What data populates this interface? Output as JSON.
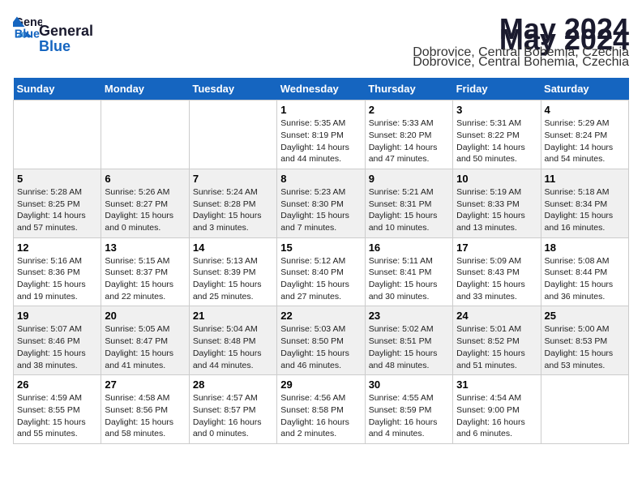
{
  "header": {
    "logo_general": "General",
    "logo_blue": "Blue",
    "month_year": "May 2024",
    "location": "Dobrovice, Central Bohemia, Czechia"
  },
  "weekdays": [
    "Sunday",
    "Monday",
    "Tuesday",
    "Wednesday",
    "Thursday",
    "Friday",
    "Saturday"
  ],
  "weeks": [
    [
      {
        "day": "",
        "info": ""
      },
      {
        "day": "",
        "info": ""
      },
      {
        "day": "",
        "info": ""
      },
      {
        "day": "1",
        "info": "Sunrise: 5:35 AM\nSunset: 8:19 PM\nDaylight: 14 hours\nand 44 minutes."
      },
      {
        "day": "2",
        "info": "Sunrise: 5:33 AM\nSunset: 8:20 PM\nDaylight: 14 hours\nand 47 minutes."
      },
      {
        "day": "3",
        "info": "Sunrise: 5:31 AM\nSunset: 8:22 PM\nDaylight: 14 hours\nand 50 minutes."
      },
      {
        "day": "4",
        "info": "Sunrise: 5:29 AM\nSunset: 8:24 PM\nDaylight: 14 hours\nand 54 minutes."
      }
    ],
    [
      {
        "day": "5",
        "info": "Sunrise: 5:28 AM\nSunset: 8:25 PM\nDaylight: 14 hours\nand 57 minutes."
      },
      {
        "day": "6",
        "info": "Sunrise: 5:26 AM\nSunset: 8:27 PM\nDaylight: 15 hours\nand 0 minutes."
      },
      {
        "day": "7",
        "info": "Sunrise: 5:24 AM\nSunset: 8:28 PM\nDaylight: 15 hours\nand 3 minutes."
      },
      {
        "day": "8",
        "info": "Sunrise: 5:23 AM\nSunset: 8:30 PM\nDaylight: 15 hours\nand 7 minutes."
      },
      {
        "day": "9",
        "info": "Sunrise: 5:21 AM\nSunset: 8:31 PM\nDaylight: 15 hours\nand 10 minutes."
      },
      {
        "day": "10",
        "info": "Sunrise: 5:19 AM\nSunset: 8:33 PM\nDaylight: 15 hours\nand 13 minutes."
      },
      {
        "day": "11",
        "info": "Sunrise: 5:18 AM\nSunset: 8:34 PM\nDaylight: 15 hours\nand 16 minutes."
      }
    ],
    [
      {
        "day": "12",
        "info": "Sunrise: 5:16 AM\nSunset: 8:36 PM\nDaylight: 15 hours\nand 19 minutes."
      },
      {
        "day": "13",
        "info": "Sunrise: 5:15 AM\nSunset: 8:37 PM\nDaylight: 15 hours\nand 22 minutes."
      },
      {
        "day": "14",
        "info": "Sunrise: 5:13 AM\nSunset: 8:39 PM\nDaylight: 15 hours\nand 25 minutes."
      },
      {
        "day": "15",
        "info": "Sunrise: 5:12 AM\nSunset: 8:40 PM\nDaylight: 15 hours\nand 27 minutes."
      },
      {
        "day": "16",
        "info": "Sunrise: 5:11 AM\nSunset: 8:41 PM\nDaylight: 15 hours\nand 30 minutes."
      },
      {
        "day": "17",
        "info": "Sunrise: 5:09 AM\nSunset: 8:43 PM\nDaylight: 15 hours\nand 33 minutes."
      },
      {
        "day": "18",
        "info": "Sunrise: 5:08 AM\nSunset: 8:44 PM\nDaylight: 15 hours\nand 36 minutes."
      }
    ],
    [
      {
        "day": "19",
        "info": "Sunrise: 5:07 AM\nSunset: 8:46 PM\nDaylight: 15 hours\nand 38 minutes."
      },
      {
        "day": "20",
        "info": "Sunrise: 5:05 AM\nSunset: 8:47 PM\nDaylight: 15 hours\nand 41 minutes."
      },
      {
        "day": "21",
        "info": "Sunrise: 5:04 AM\nSunset: 8:48 PM\nDaylight: 15 hours\nand 44 minutes."
      },
      {
        "day": "22",
        "info": "Sunrise: 5:03 AM\nSunset: 8:50 PM\nDaylight: 15 hours\nand 46 minutes."
      },
      {
        "day": "23",
        "info": "Sunrise: 5:02 AM\nSunset: 8:51 PM\nDaylight: 15 hours\nand 48 minutes."
      },
      {
        "day": "24",
        "info": "Sunrise: 5:01 AM\nSunset: 8:52 PM\nDaylight: 15 hours\nand 51 minutes."
      },
      {
        "day": "25",
        "info": "Sunrise: 5:00 AM\nSunset: 8:53 PM\nDaylight: 15 hours\nand 53 minutes."
      }
    ],
    [
      {
        "day": "26",
        "info": "Sunrise: 4:59 AM\nSunset: 8:55 PM\nDaylight: 15 hours\nand 55 minutes."
      },
      {
        "day": "27",
        "info": "Sunrise: 4:58 AM\nSunset: 8:56 PM\nDaylight: 15 hours\nand 58 minutes."
      },
      {
        "day": "28",
        "info": "Sunrise: 4:57 AM\nSunset: 8:57 PM\nDaylight: 16 hours\nand 0 minutes."
      },
      {
        "day": "29",
        "info": "Sunrise: 4:56 AM\nSunset: 8:58 PM\nDaylight: 16 hours\nand 2 minutes."
      },
      {
        "day": "30",
        "info": "Sunrise: 4:55 AM\nSunset: 8:59 PM\nDaylight: 16 hours\nand 4 minutes."
      },
      {
        "day": "31",
        "info": "Sunrise: 4:54 AM\nSunset: 9:00 PM\nDaylight: 16 hours\nand 6 minutes."
      },
      {
        "day": "",
        "info": ""
      }
    ]
  ]
}
